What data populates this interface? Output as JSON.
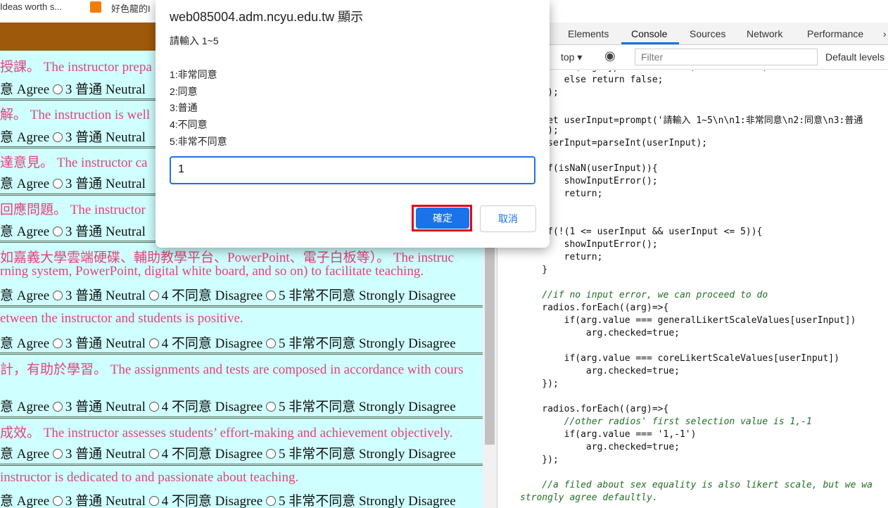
{
  "bookmarks": [
    "Ideas worth s...",
    "好色龍的I"
  ],
  "questions": [
    {
      "text": "授課。 The instructor prepa",
      "opt": "意 Agree ◦3 普通 Neutral"
    },
    {
      "text": "解。 The instruction is well",
      "opt": "意 Agree ◦3 普通 Neutral"
    },
    {
      "text": "達意見。 The instructor ca",
      "opt": "意 Agree ◦3 普通 Neutral"
    },
    {
      "text": "回應問題。 The instructor",
      "opt": "意 Agree ◦3 普通 Neutral"
    }
  ],
  "q5_line1": "如嘉義大學雲端硬碟、輔助教學平台、PowerPoint、電子白板等）。 The instruc",
  "q5_line2": "rning system, PowerPoint, digital white board, and so on) to facilitate teaching.",
  "q6_text": "etween the instructor and students is positive.",
  "q7_text": "計，有助於學習。 The assignments and tests are composed in accordance with cours",
  "q8_text": "成效。 The instructor assesses students’ effort-making and achievement objectively.",
  "q9_text": " instructor is dedicated to and passionate about teaching.",
  "options": {
    "agree": "意 Agree",
    "o3": "3 普通 Neutral",
    "o4": "4 不同意 Disagree",
    "o5": "5 非常不同意 Strongly Disagree"
  },
  "devtools": {
    "tabs": [
      "Elements",
      "Console",
      "Sources",
      "Network",
      "Performance"
    ],
    "context": "top",
    "filter_placeholder": "Filter",
    "levels": "Default levels"
  },
  "dialog": {
    "title": "web085004.adm.ncyu.edu.tw 顯示",
    "prompt": "請輸入 1~5",
    "lines": [
      "1:非常同意",
      "2:同意",
      "3:普通",
      "4:不同意",
      "5:非常不同意"
    ],
    "input_value": "1",
    "ok": "確定",
    "cancel": "取消"
  },
  "code_lines": [
    "        if(arg.type === 'radio') return true;",
    "        else return false;",
    "    });",
    "",
    "    let userInput=prompt('請輸入 1~5\\n\\n1:非常同意\\n2:同意\\n3:普通",
    "    ');",
    "    userInput=parseInt(userInput);",
    "",
    "    if(isNaN(userInput)){",
    "        showInputError();",
    "        return;",
    "    }",
    "",
    "    if(!(1 <= userInput && userInput <= 5)){",
    "        showInputError();",
    "        return;",
    "    }",
    "",
    "    //if no input error, we can proceed to do",
    "    radios.forEach((arg)=>{",
    "        if(arg.value === generalLikertScaleValues[userInput])",
    "            arg.checked=true;",
    "",
    "        if(arg.value === coreLikertScaleValues[userInput])",
    "            arg.checked=true;",
    "    });",
    "",
    "    radios.forEach((arg)=>{",
    "        //other radios' first selection value is 1,-1",
    "        if(arg.value === '1,-1')",
    "            arg.checked=true;",
    "    });",
    "",
    "    //a filed about sex equality is also likert scale, but we wa",
    "strongly agree defaultly."
  ]
}
